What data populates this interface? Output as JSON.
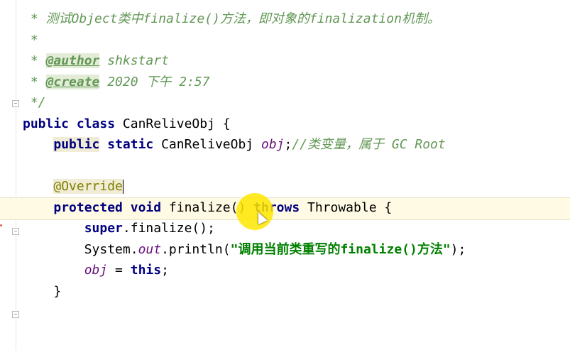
{
  "editor": {
    "lines": [
      {
        "id": "doc1",
        "parts": [
          {
            "cls": "comment",
            "t": " * 测试Object类中finalize()方法，即对象的finalization机制。"
          }
        ]
      },
      {
        "id": "doc2",
        "parts": [
          {
            "cls": "comment",
            "t": " *"
          }
        ]
      },
      {
        "id": "doc3",
        "parts": [
          {
            "cls": "comment",
            "t": " * "
          },
          {
            "cls": "tag",
            "t": "@author"
          },
          {
            "cls": "tagval",
            "t": " shkstart"
          }
        ]
      },
      {
        "id": "doc4",
        "parts": [
          {
            "cls": "comment",
            "t": " * "
          },
          {
            "cls": "tag",
            "t": "@create"
          },
          {
            "cls": "tagval",
            "t": " 2020 下午 2:57"
          }
        ]
      },
      {
        "id": "doc5",
        "parts": [
          {
            "cls": "comment",
            "t": " */"
          }
        ]
      },
      {
        "id": "class",
        "parts": [
          {
            "cls": "kw",
            "t": "public class "
          },
          {
            "cls": "plain",
            "t": "CanReliveObj {"
          }
        ]
      },
      {
        "id": "field",
        "parts": [
          {
            "cls": "plain",
            "t": "    "
          },
          {
            "cls": "kw hl",
            "t": "public"
          },
          {
            "cls": "kw",
            "t": " static "
          },
          {
            "cls": "plain",
            "t": "CanReliveObj "
          },
          {
            "cls": "field",
            "t": "obj"
          },
          {
            "cls": "plain",
            "t": ";"
          },
          {
            "cls": "comment",
            "t": "//类变量，属于 GC Root"
          }
        ]
      },
      {
        "id": "blank1",
        "parts": [
          {
            "cls": "plain",
            "t": " "
          }
        ]
      },
      {
        "id": "override",
        "parts": [
          {
            "cls": "plain",
            "t": "    "
          },
          {
            "cls": "ann hl",
            "t": "@Override"
          },
          {
            "cls": "caret",
            "t": ""
          }
        ]
      },
      {
        "id": "method",
        "parts": [
          {
            "cls": "plain",
            "t": "    "
          },
          {
            "cls": "kw",
            "t": "protected void "
          },
          {
            "cls": "plain",
            "t": "finalize() "
          },
          {
            "cls": "kw",
            "t": "throws "
          },
          {
            "cls": "plain",
            "t": "Throwable {"
          }
        ]
      },
      {
        "id": "super",
        "parts": [
          {
            "cls": "plain",
            "t": "        "
          },
          {
            "cls": "kw",
            "t": "super"
          },
          {
            "cls": "plain",
            "t": ".finalize();"
          }
        ]
      },
      {
        "id": "println",
        "parts": [
          {
            "cls": "plain",
            "t": "        System."
          },
          {
            "cls": "field",
            "t": "out"
          },
          {
            "cls": "plain",
            "t": ".println("
          },
          {
            "cls": "str",
            "t": "\"调用当前类重写的finalize()方法\""
          },
          {
            "cls": "plain",
            "t": ");"
          }
        ]
      },
      {
        "id": "assign",
        "parts": [
          {
            "cls": "plain",
            "t": "        "
          },
          {
            "cls": "field",
            "t": "obj"
          },
          {
            "cls": "plain",
            "t": " = "
          },
          {
            "cls": "kw",
            "t": "this"
          },
          {
            "cls": "plain",
            "t": ";"
          }
        ]
      },
      {
        "id": "close",
        "parts": [
          {
            "cls": "plain",
            "t": "    }"
          }
        ]
      }
    ]
  }
}
